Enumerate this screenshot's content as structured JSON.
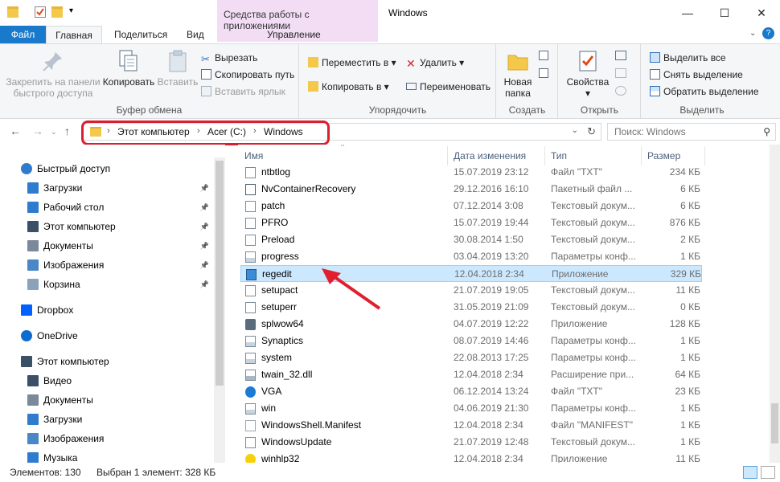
{
  "titlebar": {
    "context_tools": "Средства работы с приложениями",
    "title": "Windows",
    "minimize": "—",
    "maximize": "☐",
    "close": "✕"
  },
  "tabs": {
    "file": "Файл",
    "home": "Главная",
    "share": "Поделиться",
    "view": "Вид",
    "manage": "Управление"
  },
  "ribbon": {
    "clipboard": {
      "label": "Буфер обмена",
      "pin": "Закрепить на панели быстрого доступа",
      "copy": "Копировать",
      "paste": "Вставить",
      "cut": "Вырезать",
      "copy_path": "Скопировать путь",
      "paste_shortcut": "Вставить ярлык"
    },
    "organize": {
      "label": "Упорядочить",
      "move_to": "Переместить в",
      "copy_to": "Копировать в",
      "delete": "Удалить",
      "rename": "Переименовать"
    },
    "new": {
      "label": "Создать",
      "new_folder": "Новая папка"
    },
    "open": {
      "label": "Открыть",
      "properties": "Свойства"
    },
    "select": {
      "label": "Выделить",
      "select_all": "Выделить все",
      "select_none": "Снять выделение",
      "invert": "Обратить выделение"
    }
  },
  "address": {
    "crumbs": [
      "Этот компьютер",
      "Acer (C:)",
      "Windows"
    ],
    "search_placeholder": "Поиск: Windows"
  },
  "navpane": {
    "items": [
      {
        "label": "Быстрый доступ",
        "icon": "star-icon",
        "pinned": false,
        "indent": 1
      },
      {
        "label": "Загрузки",
        "icon": "download-icon",
        "pinned": true,
        "indent": 2
      },
      {
        "label": "Рабочий стол",
        "icon": "desktop-icon",
        "pinned": true,
        "indent": 2
      },
      {
        "label": "Этот компьютер",
        "icon": "computer-icon",
        "pinned": true,
        "indent": 2
      },
      {
        "label": "Документы",
        "icon": "documents-icon",
        "pinned": true,
        "indent": 2
      },
      {
        "label": "Изображения",
        "icon": "pictures-icon",
        "pinned": true,
        "indent": 2
      },
      {
        "label": "Корзина",
        "icon": "recycle-bin-icon",
        "pinned": true,
        "indent": 2
      },
      {
        "label": "Dropbox",
        "icon": "dropbox-icon",
        "pinned": false,
        "indent": 1
      },
      {
        "label": "OneDrive",
        "icon": "onedrive-icon",
        "pinned": false,
        "indent": 1
      },
      {
        "label": "Этот компьютер",
        "icon": "computer-icon",
        "pinned": false,
        "indent": 1
      },
      {
        "label": "Видео",
        "icon": "video-icon",
        "pinned": false,
        "indent": 2
      },
      {
        "label": "Документы",
        "icon": "documents-icon",
        "pinned": false,
        "indent": 2
      },
      {
        "label": "Загрузки",
        "icon": "download-icon",
        "pinned": false,
        "indent": 2
      },
      {
        "label": "Изображения",
        "icon": "pictures-icon",
        "pinned": false,
        "indent": 2
      },
      {
        "label": "Музыка",
        "icon": "music-icon",
        "pinned": false,
        "indent": 2
      }
    ]
  },
  "filelist": {
    "columns": {
      "name": "Имя",
      "date": "Дата изменения",
      "type": "Тип",
      "size": "Размер"
    },
    "rows": [
      {
        "name": "ntbtlog",
        "date": "15.07.2019 23:12",
        "type": "Файл \"TXT\"",
        "size": "234 КБ",
        "icon": "text-file-icon",
        "selected": false
      },
      {
        "name": "NvContainerRecovery",
        "date": "29.12.2016 16:10",
        "type": "Пакетный файл ...",
        "size": "6 КБ",
        "icon": "batch-file-icon",
        "selected": false
      },
      {
        "name": "patch",
        "date": "07.12.2014 3:08",
        "type": "Текстовый докум...",
        "size": "6 КБ",
        "icon": "text-file-icon",
        "selected": false
      },
      {
        "name": "PFRO",
        "date": "15.07.2019 19:44",
        "type": "Текстовый докум...",
        "size": "876 КБ",
        "icon": "text-file-icon",
        "selected": false
      },
      {
        "name": "Preload",
        "date": "30.08.2014 1:50",
        "type": "Текстовый докум...",
        "size": "2 КБ",
        "icon": "text-file-icon",
        "selected": false
      },
      {
        "name": "progress",
        "date": "03.04.2019 13:20",
        "type": "Параметры конф...",
        "size": "1 КБ",
        "icon": "config-file-icon",
        "selected": false
      },
      {
        "name": "regedit",
        "date": "12.04.2018 2:34",
        "type": "Приложение",
        "size": "329 КБ",
        "icon": "regedit-icon",
        "selected": true
      },
      {
        "name": "setupact",
        "date": "21.07.2019 19:05",
        "type": "Текстовый докум...",
        "size": "11 КБ",
        "icon": "text-file-icon",
        "selected": false
      },
      {
        "name": "setuperr",
        "date": "31.05.2019 21:09",
        "type": "Текстовый докум...",
        "size": "0 КБ",
        "icon": "text-file-icon",
        "selected": false
      },
      {
        "name": "splwow64",
        "date": "04.07.2019 12:22",
        "type": "Приложение",
        "size": "128 КБ",
        "icon": "printer-icon",
        "selected": false
      },
      {
        "name": "Synaptics",
        "date": "08.07.2019 14:46",
        "type": "Параметры конф...",
        "size": "1 КБ",
        "icon": "config-file-icon",
        "selected": false
      },
      {
        "name": "system",
        "date": "22.08.2013 17:25",
        "type": "Параметры конф...",
        "size": "1 КБ",
        "icon": "config-file-icon",
        "selected": false
      },
      {
        "name": "twain_32.dll",
        "date": "12.04.2018 2:34",
        "type": "Расширение при...",
        "size": "64 КБ",
        "icon": "dll-file-icon",
        "selected": false
      },
      {
        "name": "VGA",
        "date": "06.12.2014 13:24",
        "type": "Файл \"TXT\"",
        "size": "23 КБ",
        "icon": "edge-txt-icon",
        "selected": false
      },
      {
        "name": "win",
        "date": "04.06.2019 21:30",
        "type": "Параметры конф...",
        "size": "1 КБ",
        "icon": "config-file-icon",
        "selected": false
      },
      {
        "name": "WindowsShell.Manifest",
        "date": "12.04.2018 2:34",
        "type": "Файл \"MANIFEST\"",
        "size": "1 КБ",
        "icon": "blank-file-icon",
        "selected": false
      },
      {
        "name": "WindowsUpdate",
        "date": "21.07.2019 12:48",
        "type": "Текстовый докум...",
        "size": "1 КБ",
        "icon": "text-file-icon",
        "selected": false
      },
      {
        "name": "winhlp32",
        "date": "12.04.2018 2:34",
        "type": "Приложение",
        "size": "11 КБ",
        "icon": "help-icon",
        "selected": false
      }
    ]
  },
  "status": {
    "count": "Элементов: 130",
    "selection": "Выбран 1 элемент: 328 КБ"
  }
}
